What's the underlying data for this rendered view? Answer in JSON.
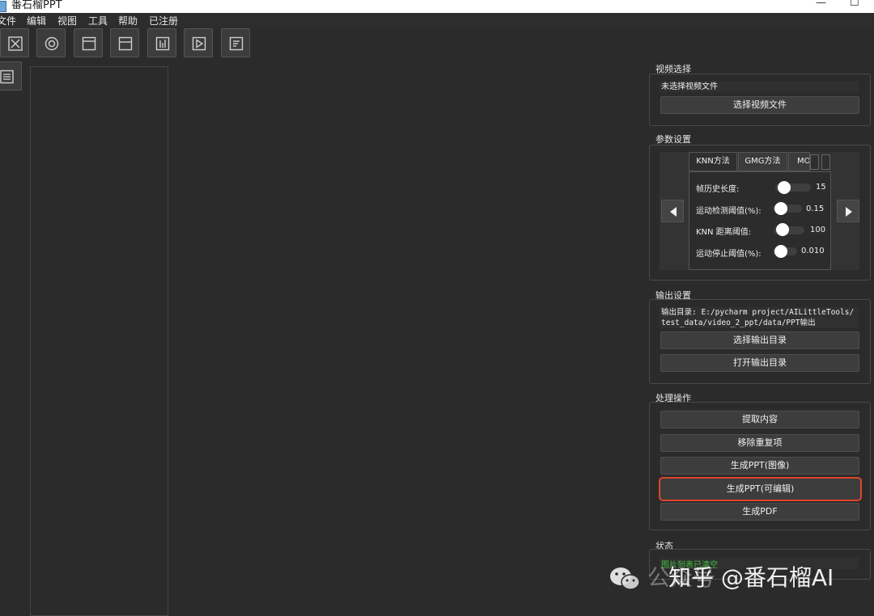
{
  "window": {
    "title": "番石榴PPT"
  },
  "menu": {
    "items": [
      "文件",
      "编辑",
      "视图",
      "工具",
      "帮助",
      "已注册"
    ]
  },
  "video_select": {
    "group_title": "视频选择",
    "file_label": "未选择视频文件",
    "select_button": "选择视频文件"
  },
  "params": {
    "group_title": "参数设置",
    "tabs": [
      "KNN方法",
      "GMG方法",
      "MOG"
    ],
    "rows": [
      {
        "label": "帧历史长度:",
        "value": "15",
        "level": 0.0
      },
      {
        "label": "运动检测阈值(%):",
        "value": "0.15",
        "level": 0.0
      },
      {
        "label": "KNN 距离阈值:",
        "value": "100",
        "level": 0.0
      },
      {
        "label": "运动停止阈值(%):",
        "value": "0.010",
        "level": 0.0
      }
    ]
  },
  "output": {
    "group_title": "输出设置",
    "dir_line1": "输出目录: E:/pycharm project/AILittleTools/",
    "dir_line2": "test_data/video_2_ppt/data/PPT输出",
    "select_button": "选择输出目录",
    "open_button": "打开输出目录"
  },
  "actions": {
    "group_title": "处理操作",
    "extract": "提取内容",
    "remove_dup": "移除重复项",
    "gen_ppt_image": "生成PPT(图像)",
    "gen_ppt_editable": "生成PPT(可编辑)",
    "gen_pdf": "生成PDF"
  },
  "status": {
    "group_title": "状态",
    "text": "图片列表已清空"
  },
  "watermark": {
    "prefix": "公众号",
    "text": "知乎 @番石榴AI"
  },
  "colors": {
    "highlight": "#e0452a",
    "status_text": "#3fbf3f"
  }
}
